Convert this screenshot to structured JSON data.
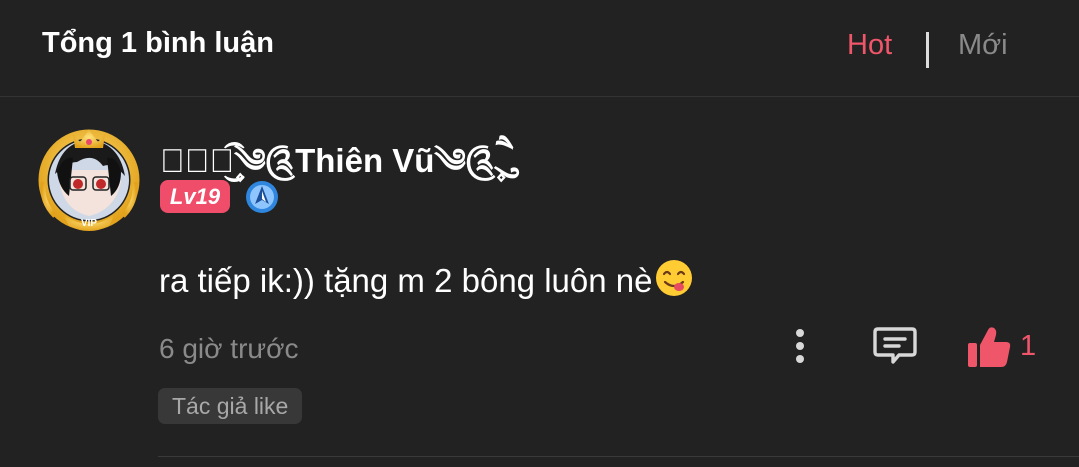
{
  "header": {
    "title": "Tổng 1 bình luận",
    "sort_hot": "Hot",
    "sort_new": "Mới"
  },
  "comment": {
    "username": "⊱ཻུ۪۪͜͡༄༊Thiên Vũ༄༊ཻུ۪۪",
    "level": "Lv19",
    "avatar_badge": "VIP",
    "text": "ra tiếp ik:)) tặng m 2 bông luôn nè",
    "emoji_icon": "face-savoring-food-icon",
    "timestamp": "6 giờ trước",
    "like_count": "1",
    "author_like_tag": "Tác giả like"
  },
  "colors": {
    "background": "#222222",
    "accent": "#f0566a",
    "muted_text": "#8a8a8a",
    "level_badge": "#ef4d6a",
    "rank_icon": "#2e86de"
  }
}
